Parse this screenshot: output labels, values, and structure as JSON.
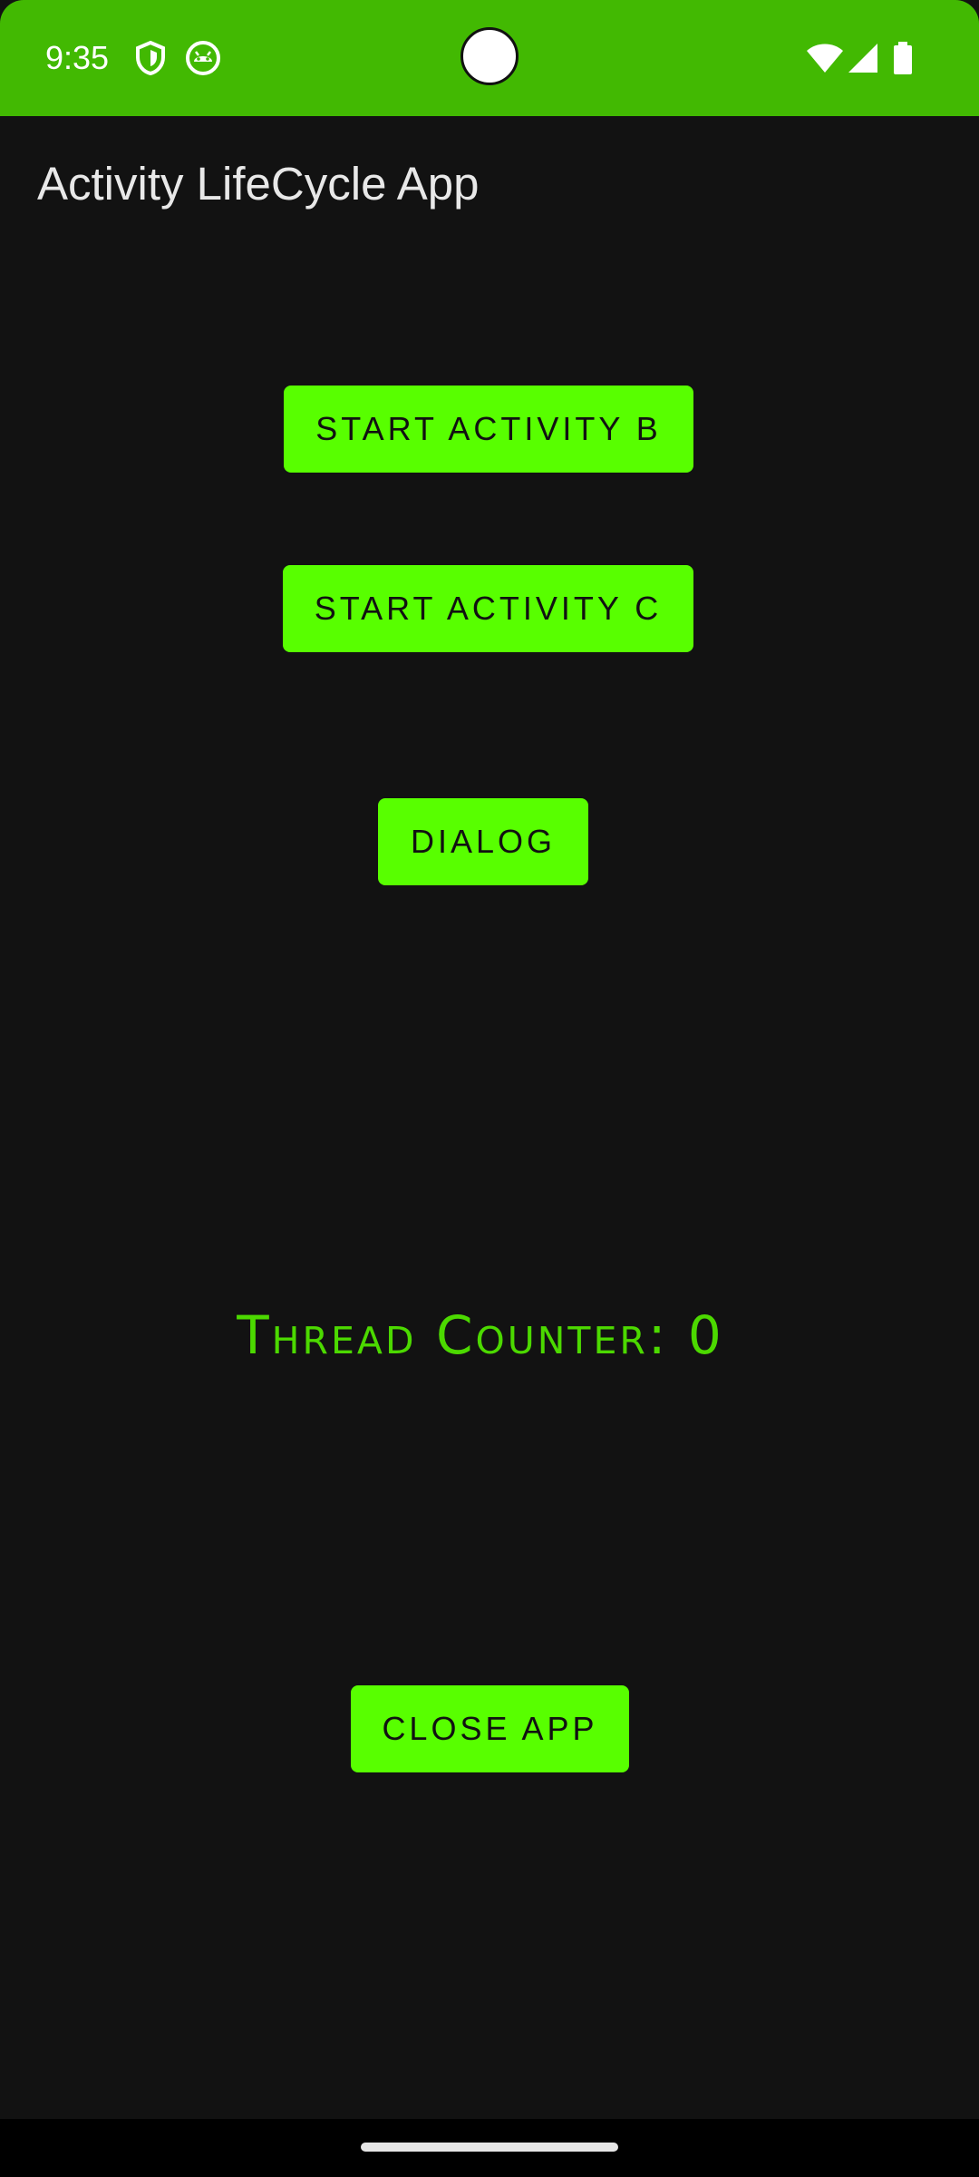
{
  "status_bar": {
    "time": "9:35",
    "left_icons": [
      "shield-icon",
      "android-bot-icon"
    ],
    "right_icons": [
      "wifi-icon",
      "cellular-signal-icon",
      "battery-icon"
    ],
    "background_color": "#42b902"
  },
  "app_bar": {
    "title": "Activity LifeCycle App"
  },
  "buttons": {
    "start_activity_b": "START ACTIVITY B",
    "start_activity_c": "START ACTIVITY C",
    "dialog": "DIALOG",
    "close_app": "CLOSE APP"
  },
  "counter": {
    "text": "Thread Counter: 0"
  },
  "colors": {
    "accent": "#58ff00",
    "counter_text": "#4cd900",
    "background": "#121212"
  }
}
